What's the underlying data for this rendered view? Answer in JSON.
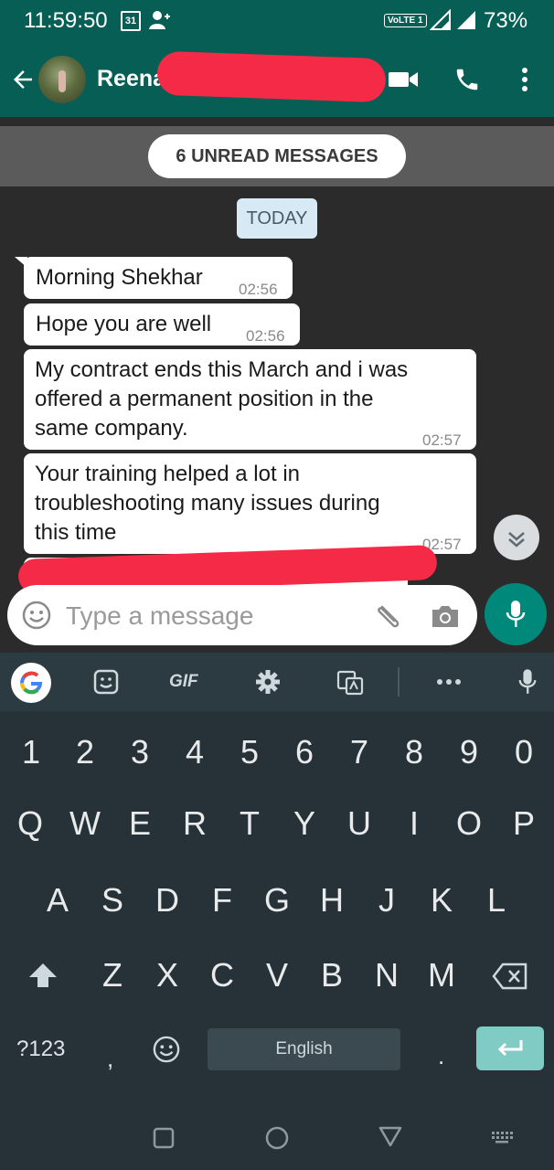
{
  "status_bar": {
    "time": "11:59:50",
    "calendar_day": "31",
    "network_label": "VoLTE 1",
    "battery": "73%"
  },
  "app_bar": {
    "contact_name": "Reena"
  },
  "chat": {
    "unread_banner": "6 UNREAD MESSAGES",
    "date_chip": "TODAY",
    "messages": [
      {
        "lines": [
          "Morning Shekhar"
        ],
        "time": "02:56"
      },
      {
        "lines": [
          "Hope you are well"
        ],
        "time": "02:56"
      },
      {
        "lines": [
          "My contract ends this March and i was",
          "offered a permanent position in the",
          "same company."
        ],
        "time": "02:57"
      },
      {
        "lines": [
          "Your training helped a lot in",
          "troubleshooting many issues during",
          "this time"
        ],
        "time": "02:57"
      }
    ]
  },
  "composer": {
    "placeholder": "Type a message"
  },
  "keyboard": {
    "toolbar": {
      "gif": "GIF"
    },
    "number_row": [
      "1",
      "2",
      "3",
      "4",
      "5",
      "6",
      "7",
      "8",
      "9",
      "0"
    ],
    "row_q": [
      "Q",
      "W",
      "E",
      "R",
      "T",
      "Y",
      "U",
      "I",
      "O",
      "P"
    ],
    "row_a": [
      "A",
      "S",
      "D",
      "F",
      "G",
      "H",
      "J",
      "K",
      "L"
    ],
    "row_z": [
      "Z",
      "X",
      "C",
      "V",
      "B",
      "N",
      "M"
    ],
    "symbols_key": "?123",
    "comma_key": ",",
    "period_key": ".",
    "space_label": "English"
  },
  "colors": {
    "header": "#075e54",
    "accent": "#00897b",
    "keyboard_bg": "#263238",
    "redaction": "#f52a46"
  }
}
